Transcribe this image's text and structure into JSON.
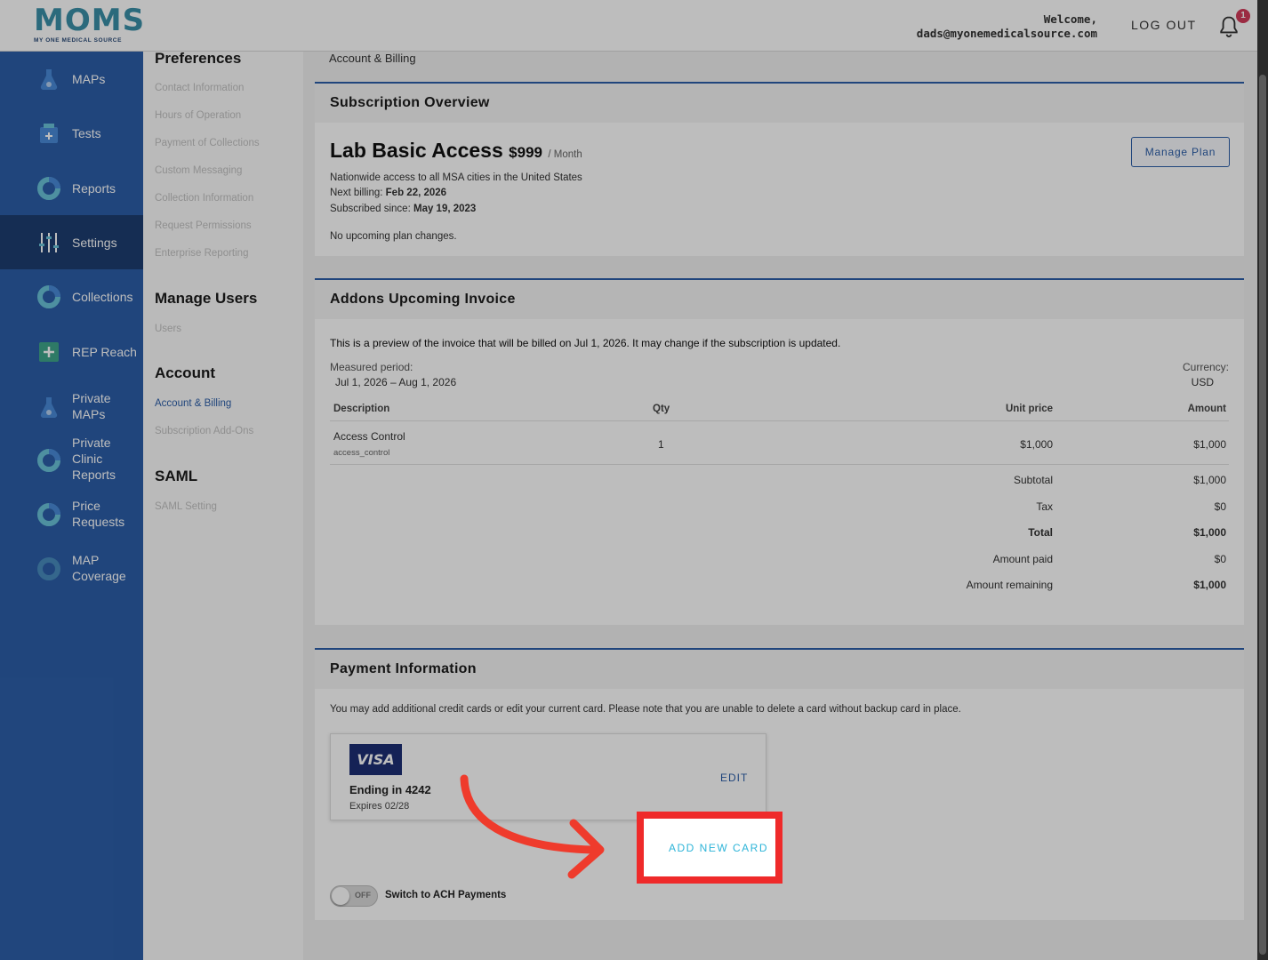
{
  "header": {
    "logo_text": "MOMS",
    "logo_sub": "MY ONE MEDICAL SOURCE",
    "welcome_label": "Welcome,",
    "email": "dads@myonemedicalsource.com",
    "logout": "LOG OUT",
    "notification_count": "1"
  },
  "sidebar": {
    "items": [
      {
        "label": "MAPs",
        "icon": "flask-icon"
      },
      {
        "label": "Tests",
        "icon": "test-kit-icon"
      },
      {
        "label": "Reports",
        "icon": "donut-chart-icon"
      },
      {
        "label": "Settings",
        "icon": "sliders-icon"
      },
      {
        "label": "Collections",
        "icon": "donut-chart-icon"
      },
      {
        "label": "REP Reach",
        "icon": "plus-box-icon"
      },
      {
        "label": "Private MAPs",
        "icon": "flask-icon"
      },
      {
        "label": "Private Clinic Reports",
        "icon": "donut-chart-icon"
      },
      {
        "label": "Price Requests",
        "icon": "donut-chart-icon"
      },
      {
        "label": "MAP Coverage",
        "icon": "map-icon"
      }
    ]
  },
  "settings": {
    "preferences_title": "Preferences",
    "preferences": [
      "Contact Information",
      "Hours of Operation",
      "Payment of Collections",
      "Custom Messaging",
      "Collection Information",
      "Request Permissions",
      "Enterprise Reporting"
    ],
    "manage_users_title": "Manage Users",
    "manage_users": [
      "Users"
    ],
    "account_title": "Account",
    "account": [
      "Account & Billing",
      "Subscription Add-Ons"
    ],
    "saml_title": "SAML",
    "saml": [
      "SAML Setting"
    ]
  },
  "main": {
    "breadcrumb": "Account & Billing",
    "subscription": {
      "title": "Subscription Overview",
      "plan_name": "Lab Basic Access",
      "price": "$999",
      "per": "/ Month",
      "description": "Nationwide access to all MSA cities in the United States",
      "next_billing_label": "Next billing:",
      "next_billing": "Feb 22, 2026",
      "since_label": "Subscribed since:",
      "since": "May 19, 2023",
      "changes": "No upcoming plan changes.",
      "manage_button": "Manage Plan"
    },
    "invoice": {
      "title": "Addons Upcoming Invoice",
      "preview_text": "This is a preview of the invoice that will be billed on Jul 1, 2026. It may change if the subscription is updated.",
      "period_label": "Measured period:",
      "period": "Jul 1, 2026 – Aug 1, 2026",
      "currency_label": "Currency:",
      "currency": "USD",
      "columns": {
        "description": "Description",
        "qty": "Qty",
        "unit_price": "Unit price",
        "amount": "Amount"
      },
      "row": {
        "name": "Access Control",
        "code": "access_control",
        "qty": "1",
        "unit_price": "$1,000",
        "amount": "$1,000"
      },
      "totals": [
        {
          "label": "Subtotal",
          "value": "$1,000"
        },
        {
          "label": "Tax",
          "value": "$0"
        },
        {
          "label": "Total",
          "value": "$1,000"
        },
        {
          "label": "Amount paid",
          "value": "$0"
        },
        {
          "label": "Amount remaining",
          "value": "$1,000"
        }
      ]
    },
    "payment": {
      "title": "Payment Information",
      "note": "You may add additional credit cards or edit your current card. Please note that you are unable to delete a card without backup card in place.",
      "card_brand": "VISA",
      "card_ending": "Ending in 4242",
      "card_expires": "Expires 02/28",
      "edit": "EDIT",
      "add_card": "ADD NEW CARD",
      "toggle_state": "OFF",
      "toggle_label": "Switch to ACH Payments"
    }
  },
  "colors": {
    "primary": "#2c5ea8",
    "sidebar_active": "#1d3d70",
    "highlight": "#ef2a2a",
    "link_cyan": "#2db4d8"
  }
}
